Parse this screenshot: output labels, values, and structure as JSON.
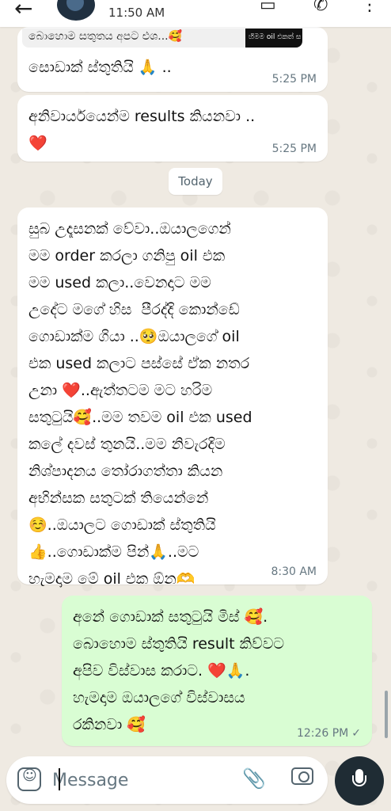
{
  "status_bar": {
    "time": "11:50 AM"
  },
  "header": {
    "back_icon": "arrow-left-icon",
    "avatar_icon": "contact-avatar",
    "icons": [
      "video-call-icon",
      "phone-icon",
      "more-vert-icon"
    ]
  },
  "quoted": {
    "text": "බොහොම සතුතය අපට එශ...🥰",
    "thumb_text": "හිමම oil එකත් ස"
  },
  "messages": [
    {
      "id": "m1",
      "direction": "in",
      "text": "සොඩාක් ස්තුතියි 🙏 ..",
      "time": "5:25 PM"
    },
    {
      "id": "m2",
      "direction": "in",
      "text": "අනිවාර්යයෙන්ම results කියනවා ..\n❤️",
      "time": "5:25 PM"
    },
    {
      "id": "m3",
      "direction": "in",
      "text": "සුබ උදෑසනක් වේවා..ඔයාලගෙන්\nමම order කරලා ගනිපු oil එක\nමම used කලා..වෙනදාට මම\nඋදේට මගේ හිස  පීරද්දි කොන්ඩේ\nගොඩාක්ම ගියා ..🥺ඔයාලගේ oil\nඑක used කලාට පස්සේ ඒක නතර\nඋනා ❤️..ඇත්තටම මට හරිම\nසතුටුයි🥰..මම තවම oil එක used\nකලේ දවස් තුනයි..මම නිවැරදිම\nනිශ්පාදනය තෝරාගත්තා කියන\nඅභින්සක සතුටක් තියෙන්නේ\n☺️..ඔයාලට ගොඩාක් ස්තුතියි\n👍..ගොඩාක්ම පින්🙏..මට\nහැමදාම මේ oil එක ඕන🫶",
      "time": "8:30 AM"
    },
    {
      "id": "m4",
      "direction": "out",
      "text": "අනේ ගොඩාක් සතුටුයි මිස් 🥰.\nබොහොම ස්තුතියි result කිව්වට\nඅපිව විස්වාස කරාට. ❤️🙏.\nහැමදාම ඔයාලගේ විස්වාසය\nරකිනවා 🥰",
      "time": "12:26 PM",
      "status": "✓"
    }
  ],
  "date_separator": "Today",
  "composer": {
    "placeholder": "Message",
    "icons": [
      "emoji-icon",
      "attach-icon",
      "camera-icon",
      "mic-icon"
    ]
  },
  "colors": {
    "background": "#efeae2",
    "incoming": "#ffffff",
    "outgoing": "#d9fdd3",
    "mic": "#1f2c34"
  }
}
